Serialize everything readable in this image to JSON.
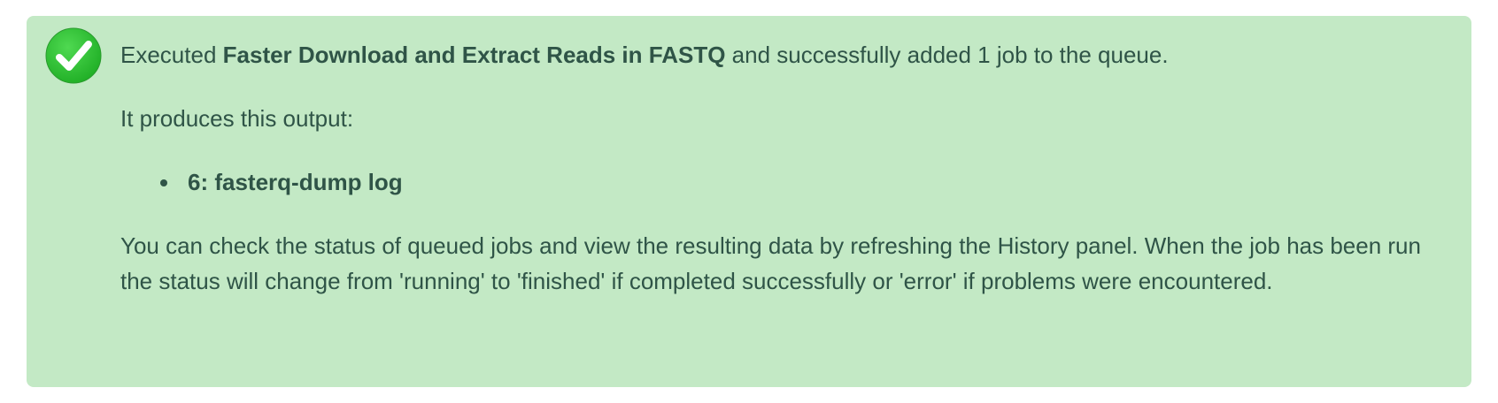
{
  "alert": {
    "status_icon": "check-circle-icon",
    "colors": {
      "background": "#c3e9c5",
      "text": "#2f5447",
      "icon_fill": "#2ec835"
    },
    "summary_prefix": "Executed ",
    "tool_name": "Faster Download and Extract Reads in FASTQ",
    "summary_suffix": " and successfully added 1 job to the queue.",
    "output_intro": "It produces this output:",
    "outputs": [
      "6: fasterq-dump log"
    ],
    "status_note": "You can check the status of queued jobs and view the resulting data by refreshing the History panel. When the job has been run the status will change from 'running' to 'finished' if completed successfully or 'error' if problems were encountered."
  }
}
